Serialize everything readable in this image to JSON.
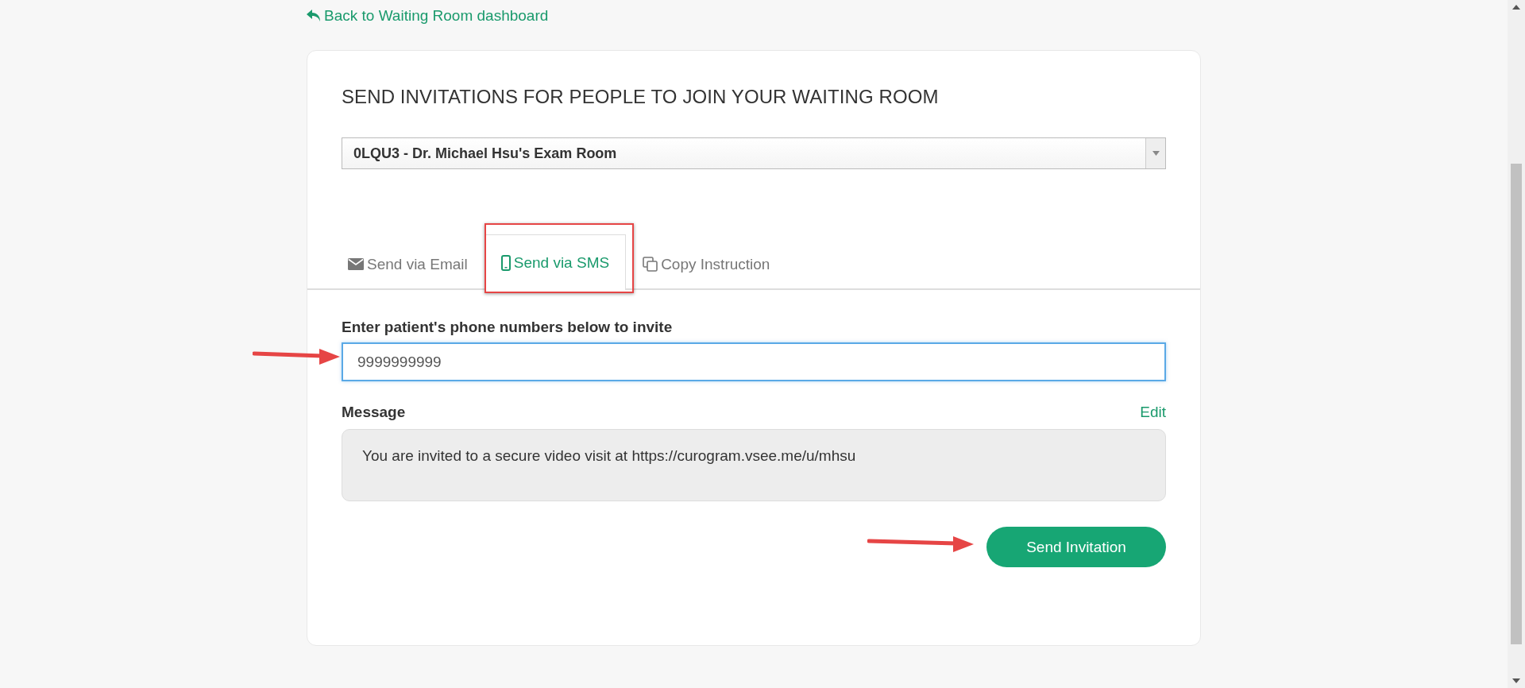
{
  "back_link": {
    "label": "Back to Waiting Room dashboard"
  },
  "card": {
    "title": "SEND INVITATIONS FOR PEOPLE TO JOIN YOUR WAITING ROOM",
    "room_select": {
      "value": "0LQU3 - Dr. Michael Hsu's Exam Room"
    },
    "tabs": [
      {
        "label": "Send via Email",
        "kind": "email",
        "selected": false
      },
      {
        "label": "Send via SMS",
        "kind": "sms",
        "selected": true
      },
      {
        "label": "Copy Instruction",
        "kind": "copy",
        "selected": false
      }
    ],
    "phone_field": {
      "label": "Enter patient's phone numbers below to invite",
      "value": "9999999999"
    },
    "message": {
      "label": "Message",
      "edit_link": "Edit",
      "text": "You are invited to a secure video visit at https://curogram.vsee.me/u/mhsu"
    },
    "send_button": "Send Invitation"
  }
}
